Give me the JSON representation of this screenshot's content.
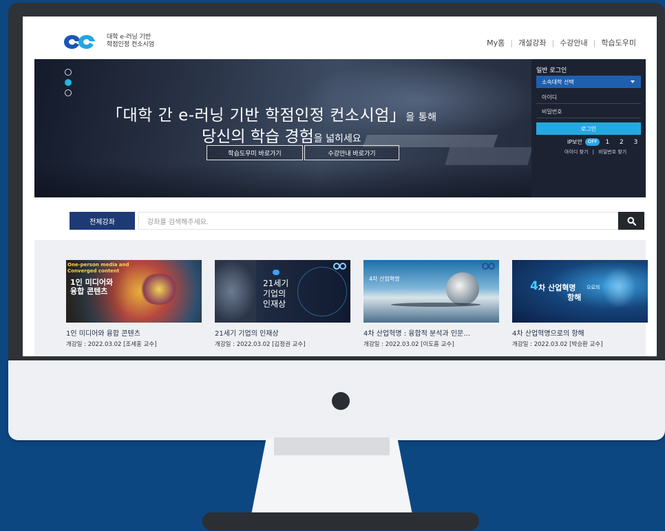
{
  "header": {
    "logo_line1": "대학 e-러닝 기반",
    "logo_line2": "학점인정 컨소시엄",
    "nav": [
      "My홈",
      "개설강좌",
      "수강안내",
      "학습도우미"
    ]
  },
  "hero": {
    "title_line1_main": "「대학 간 e-러닝 기반 학점인정 컨소시엄」",
    "title_line1_small": "을 통해",
    "title_line2_main": "당신의 학습 경험",
    "title_line2_small": "을 넓히세요",
    "buttons": [
      "학습도우미 바로가기",
      "수강안내 바로가기"
    ],
    "slides": 3,
    "active_slide": 2
  },
  "login": {
    "title": "일반 로그인",
    "university_select": "소속대학 선택",
    "id_placeholder": "아이디",
    "password_placeholder": "비밀번호",
    "login_button": "로그인",
    "ip_security_label": "IP보안",
    "ip_toggle": "OFF",
    "ip_levels": "1 2 3",
    "find_id": "아이디 찾기",
    "find_password": "비밀번호 찾기",
    "links_separator": "|"
  },
  "search": {
    "category": "전체강좌",
    "placeholder": "강좌를 검색해주세요."
  },
  "courses": [
    {
      "title": "1인 미디어와 융합 콘텐츠",
      "meta": "개강일 : 2022.03.02 [조세홍 교수]",
      "thumb_en1": "One-person media and",
      "thumb_en2": "Converged content",
      "thumb_ko1": "1인 미디어와",
      "thumb_ko2": "융합 콘텐츠"
    },
    {
      "title": "21세기 기업의 인재상",
      "meta": "개강일 : 2022.03.02 [김정권 교수]",
      "thumb_ko1": "21세기",
      "thumb_ko2": "기업의",
      "thumb_ko3": "인재상"
    },
    {
      "title": "4차 산업혁명 : 융합적 분석과 인문…",
      "meta": "개강일 : 2022.03.02 [이도흠 교수]",
      "thumb_ko1": "4차 산업혁명"
    },
    {
      "title": "4차 산업혁명으로의 항해",
      "meta": "개강일 : 2022.03.02 [박승환 교수]",
      "thumb_num": "4",
      "thumb_ko1": "차 산업혁명",
      "thumb_ko_small": "으로의",
      "thumb_ko2": "항해"
    }
  ],
  "colors": {
    "background": "#0d4781",
    "accent": "#20b8e6",
    "navy_button": "#1d3a75",
    "login_panel": "#1c2231"
  }
}
